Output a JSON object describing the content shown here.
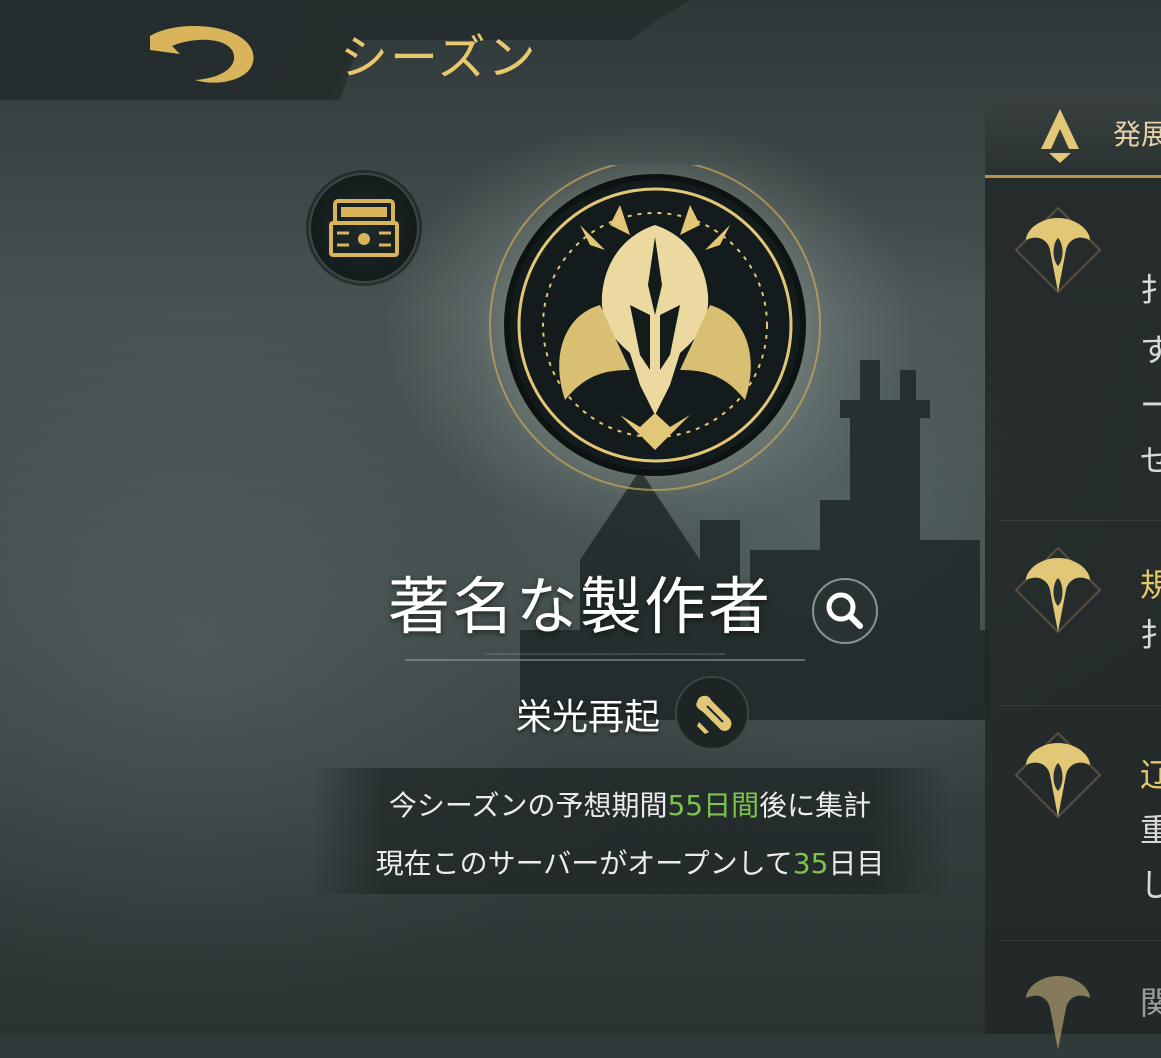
{
  "header": {
    "title": "シーズン",
    "back_icon": "back-arrow-icon"
  },
  "season": {
    "title_name": "著名な製作者",
    "subtitle": "栄光再起",
    "line1": {
      "prefix": "今シーズンの予想期間",
      "highlight": "55日間",
      "suffix": "後に集計"
    },
    "line2": {
      "prefix": "現在このサーバーがオープンして",
      "highlight": "35",
      "suffix": "日目"
    }
  },
  "right_panel": {
    "header_label": "発展",
    "rows": [
      {
        "glyphs": [
          "扌",
          "す",
          "ー",
          "せ"
        ]
      },
      {
        "glyphs": [
          "規",
          "扌"
        ]
      },
      {
        "glyphs": [
          "辽",
          "重",
          "し"
        ]
      },
      {
        "glyphs": [
          "関"
        ]
      }
    ]
  },
  "colors": {
    "gold": "#e7c86b",
    "highlight_green": "#7cc44b",
    "panel_border": "#b8934a"
  }
}
